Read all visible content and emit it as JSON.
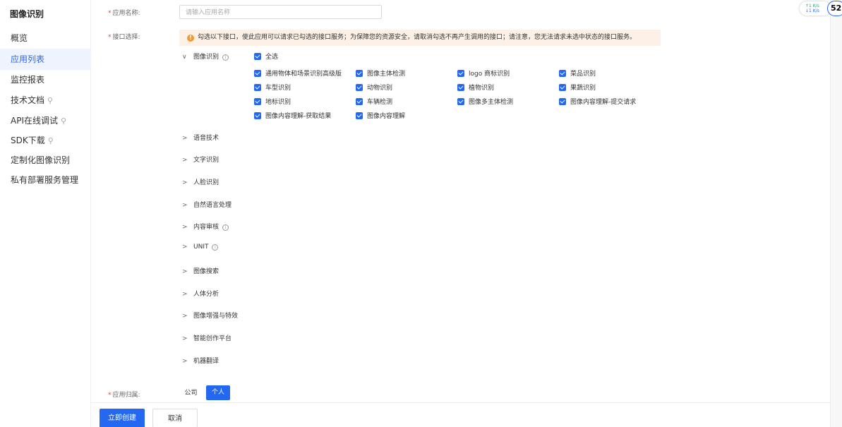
{
  "sidebar": {
    "title": "图像识别",
    "items": [
      {
        "label": "概览"
      },
      {
        "label": "应用列表"
      },
      {
        "label": "监控报表"
      },
      {
        "label": "技术文档"
      },
      {
        "label": "API在线调试"
      },
      {
        "label": "SDK下载"
      },
      {
        "label": "定制化图像识别"
      },
      {
        "label": "私有部署服务管理"
      }
    ]
  },
  "form": {
    "app_name_label": "应用名称:",
    "app_name_placeholder": "请输入应用名称",
    "api_select_label": "接口选择:",
    "notice": "勾选以下接口，使此应用可以请求已勾选的接口服务；为保障您的资源安全，请取消勾选不再产生调用的接口；请注意，您无法请求未选中状态的接口服务。",
    "expanded_group": "图像识别",
    "select_all": "全选",
    "checkboxes": [
      "通用物体和场景识别高级版",
      "图像主体检测",
      "logo 商标识别",
      "菜品识别",
      "车型识别",
      "动物识别",
      "植物识别",
      "果蔬识别",
      "地标识别",
      "车辆检测",
      "图像多主体检测",
      "图像内容理解-提交请求",
      "图像内容理解-获取结果",
      "图像内容理解"
    ],
    "collapsed_groups": [
      {
        "label": "语音技术",
        "info": false
      },
      {
        "label": "文字识别",
        "info": false
      },
      {
        "label": "人脸识别",
        "info": false
      },
      {
        "label": "自然语言处理",
        "info": false
      },
      {
        "label": "内容审核",
        "info": true
      },
      {
        "label": "UNIT",
        "info": true
      },
      {
        "label": "图像搜索",
        "info": false
      },
      {
        "label": "人体分析",
        "info": false
      },
      {
        "label": "图像增强与特效",
        "info": false
      },
      {
        "label": "智能创作平台",
        "info": false
      },
      {
        "label": "机器翻译",
        "info": false
      }
    ],
    "ownership_label": "应用归属:",
    "ownership_options": [
      "公司",
      "个人"
    ],
    "ownership_selected": "个人"
  },
  "footer": {
    "create_label": "立即创建",
    "cancel_label": "取消"
  },
  "overlay": {
    "speed_up": "↑1 K/s",
    "speed_down": "↓1 K/s",
    "badge": "52"
  },
  "colors": {
    "accent": "#2468f2",
    "notice_bg": "#fdf0e7",
    "warn": "#f09a37"
  }
}
